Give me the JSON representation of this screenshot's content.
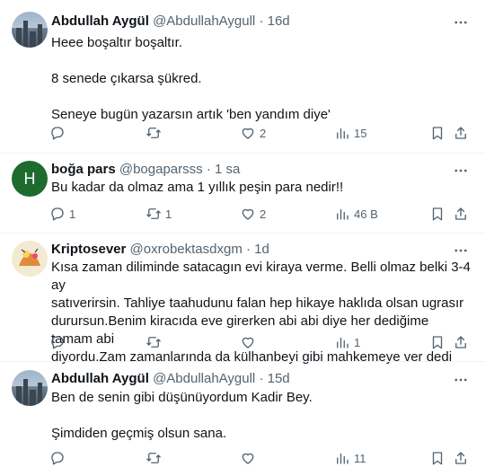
{
  "tweets": [
    {
      "name": "Abdullah Aygül",
      "handle": "@AbdullahAygull",
      "separator": "·",
      "time": "16d",
      "lines": [
        "Heee boşaltır boşaltır.",
        "8 senede çıkarsa şükred.",
        "Seneye bugün yazarsın artık 'ben yandım diye'"
      ],
      "reply_count": "",
      "retweet_count": "",
      "like_count": "2",
      "view_count": "15"
    },
    {
      "name": "boğa pars",
      "handle": "@bogaparsss",
      "separator": "·",
      "time": "1 sa",
      "avatar_letter": "H",
      "lines": [
        "Bu kadar da olmaz ama 1 yıllık peşin para nedir!!"
      ],
      "reply_count": "1",
      "retweet_count": "1",
      "like_count": "2",
      "view_count": "46 B"
    },
    {
      "name": "Kriptosever",
      "handle": "@oxrobektasdxgm",
      "separator": "·",
      "time": "1d",
      "lines": [
        "Kısa zaman diliminde satacagın evi kiraya verme. Belli olmaz belki 3-4 ay",
        "satıverirsin. Tahliye taahudunu falan hep hikaye haklıda olsan ugrasır",
        "durursun.Benim kiracıda eve girerken abi abi diye her dediğime tamam abi",
        "diyordu.Zam zamanlarında da külhanbeyi gibi mahkemeye ver dedi"
      ],
      "reply_count": "",
      "retweet_count": "",
      "like_count": "",
      "view_count": "1"
    },
    {
      "name": "Abdullah Aygül",
      "handle": "@AbdullahAygull",
      "separator": "·",
      "time": "15d",
      "lines": [
        "Ben de senin gibi düşünüyordum Kadir Bey.",
        "Şimdiden geçmiş olsun sana."
      ],
      "reply_count": "",
      "retweet_count": "",
      "like_count": "",
      "view_count": "11"
    }
  ],
  "icons": {
    "reply": "reply-icon",
    "retweet": "retweet-icon",
    "like": "heart-icon",
    "views": "views-icon",
    "bookmark": "bookmark-icon",
    "share": "share-icon",
    "more": "more-icon"
  },
  "colors": {
    "text": "#0f1419",
    "secondary": "#536471",
    "separator": "#eff3f4",
    "avatar_green": "#1e6b2e"
  }
}
